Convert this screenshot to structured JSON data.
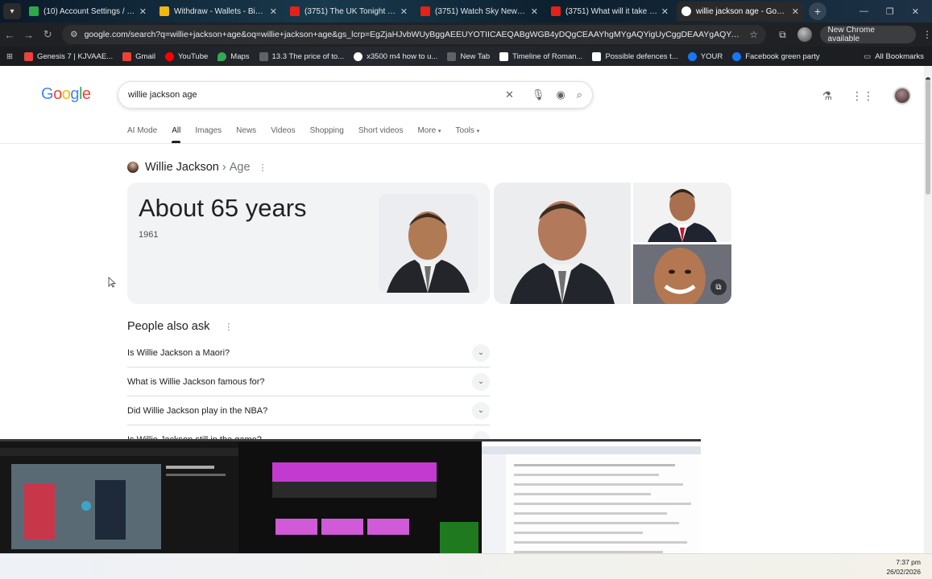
{
  "browser": {
    "tabs": [
      {
        "title": "(10) Account Settings / Stream",
        "color": "#2ea84d",
        "active": false
      },
      {
        "title": "Withdraw - Wallets - Binance",
        "color": "#f0b90b",
        "active": false
      },
      {
        "title": "(3751) The UK Tonight | Home",
        "color": "#e62117",
        "active": false
      },
      {
        "title": "(3751) Watch Sky News - YouTu",
        "color": "#e62117",
        "active": false
      },
      {
        "title": "(3751) What will it take for dog",
        "color": "#e62117",
        "active": false
      },
      {
        "title": "willie jackson age - Google Se",
        "color": "#4285f4",
        "active": true
      }
    ],
    "new_tab_label": "+",
    "url": "google.com/search?q=willie+jackson+age&oq=willie+jackson+age&gs_lcrp=EgZjaHJvbWUyBggAEEUYOTIICAEQABgWGB4yDQgCEAAYhgMYgAQYigUyCggDEAAYgAQYogQyCggEEAAYogQYiQUy...",
    "new_chrome_label": "New Chrome available",
    "bookmarks": [
      {
        "label": "Genesis 7 | KJVAAE...",
        "color": "#e8453c"
      },
      {
        "label": "Gmail",
        "color": "#ea4335"
      },
      {
        "label": "YouTube",
        "color": "#ff0000"
      },
      {
        "label": "Maps",
        "color": "#34a853"
      },
      {
        "label": "13.3 The price of to...",
        "color": "#5f6368"
      },
      {
        "label": "x3500 m4 how to u...",
        "color": "#4285f4"
      },
      {
        "label": "New Tab",
        "color": "#5f6368"
      },
      {
        "label": "Timeline of Roman...",
        "color": "#ffffff"
      },
      {
        "label": "Possible defences t...",
        "color": "#ffffff"
      },
      {
        "label": "YOUR",
        "color": "#1877f2"
      },
      {
        "label": "Facebook green party",
        "color": "#1877f2"
      }
    ],
    "all_bookmarks_label": "All Bookmarks"
  },
  "google": {
    "logo": "Google",
    "query": "willie jackson age",
    "nav_tabs": [
      "AI Mode",
      "All",
      "Images",
      "News",
      "Videos",
      "Shopping",
      "Short videos",
      "More",
      "Tools"
    ],
    "active_tab": "All",
    "knowledge": {
      "name": "Willie Jackson",
      "separator": "›",
      "attribute": "Age",
      "answer": "About 65 years",
      "year": "1961"
    },
    "people_also_ask": {
      "title": "People also ask",
      "questions": [
        "Is Willie Jackson a Maori?",
        "What is Willie Jackson famous for?",
        "Did Willie Jackson play in the NBA?",
        "Is Willie Jackson still in the game?"
      ]
    }
  },
  "taskbar": {
    "time": "7:37 pm",
    "date": "26/02/2026"
  }
}
